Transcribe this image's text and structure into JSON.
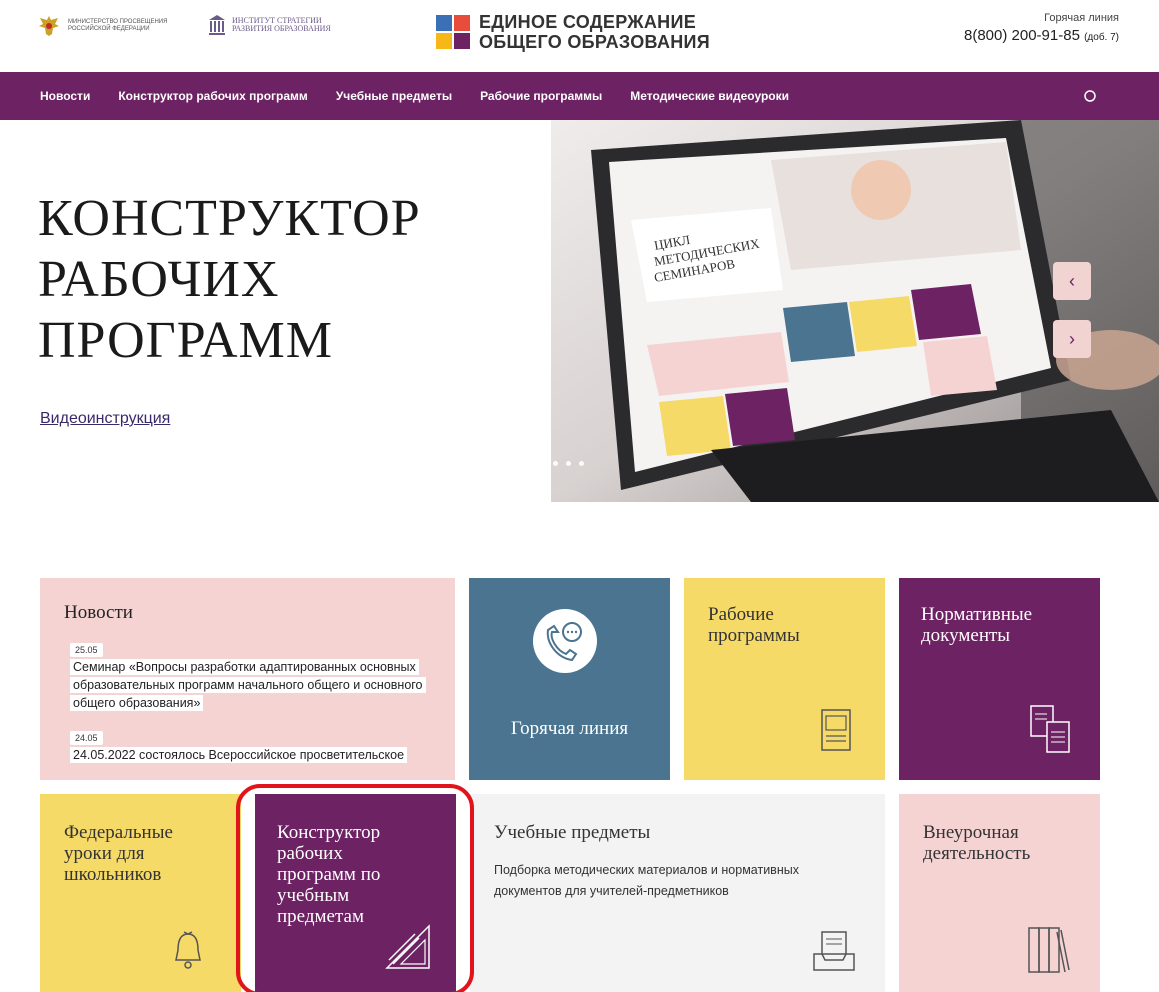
{
  "header": {
    "ministry_text": "Министерство просвещения Российской Федерации",
    "institute_text": "Институт стратегии развития образования",
    "site_title_line1": "ЕДИНОЕ СОДЕРЖАНИЕ",
    "site_title_line2": "ОБЩЕГО ОБРАЗОВАНИЯ",
    "hotline_label": "Горячая линия",
    "hotline_number": "8(800) 200-91-85",
    "hotline_ext": "(доб. 7)",
    "logo_colors": [
      "#3b6fb6",
      "#e84c3d",
      "#f5b818",
      "#6d2263"
    ]
  },
  "nav": {
    "items": [
      "Новости",
      "Конструктор рабочих программ",
      "Учебные предметы",
      "Рабочие программы",
      "Методические видеоуроки"
    ],
    "search_icon": "search-icon"
  },
  "hero": {
    "title_line1": "КОНСТРУКТОР",
    "title_line2": "РАБОЧИХ",
    "title_line3": "ПРОГРАММ",
    "video_link": "Видеоинструкция",
    "slide": {
      "heading_line1": "ЦИКЛ",
      "heading_line2": "МЕТОДИЧЕСКИХ",
      "heading_line3": "СЕМИНАРОВ"
    },
    "prev_arrow": "‹",
    "next_arrow": "›"
  },
  "tiles": {
    "news": {
      "title": "Новости",
      "items": [
        {
          "date": "25.05",
          "text": "Семинар «Вопросы разработки адаптированных основных образовательных программ начального общего и основного общего образования»"
        },
        {
          "date": "24.05",
          "text": "24.05.2022 состоялось Всероссийское просветительское"
        }
      ]
    },
    "hotline": {
      "title": "Горячая линия",
      "icon": "phone-chat-icon"
    },
    "work_programs": {
      "title_line1": "Рабочие",
      "title_line2": "программы",
      "icon": "book-icon"
    },
    "normative": {
      "title_line1": "Нормативные",
      "title_line2": "документы",
      "icon": "documents-icon"
    },
    "federal_lessons": {
      "title_line1": "Федеральные",
      "title_line2": "уроки для",
      "title_line3": "школьников",
      "icon": "bell-icon"
    },
    "constructor": {
      "title_line1": "Конструктор",
      "title_line2": "рабочих",
      "title_line3": "программ по",
      "title_line4": "учебным",
      "title_line5": "предметам",
      "icon": "ruler-triangle-icon"
    },
    "subjects": {
      "title": "Учебные предметы",
      "description": "Подборка методических материалов и нормативных документов для учителей-предметников",
      "icon": "inbox-tray-icon"
    },
    "extracurricular": {
      "title_line1": "Внеурочная",
      "title_line2": "деятельность",
      "icon": "books-icon"
    }
  },
  "colors": {
    "brand_purple": "#6d2263",
    "pink": "#f6d3d3",
    "blue": "#4a7490",
    "yellow": "#f6da68",
    "highlight_red": "#e0141a"
  }
}
